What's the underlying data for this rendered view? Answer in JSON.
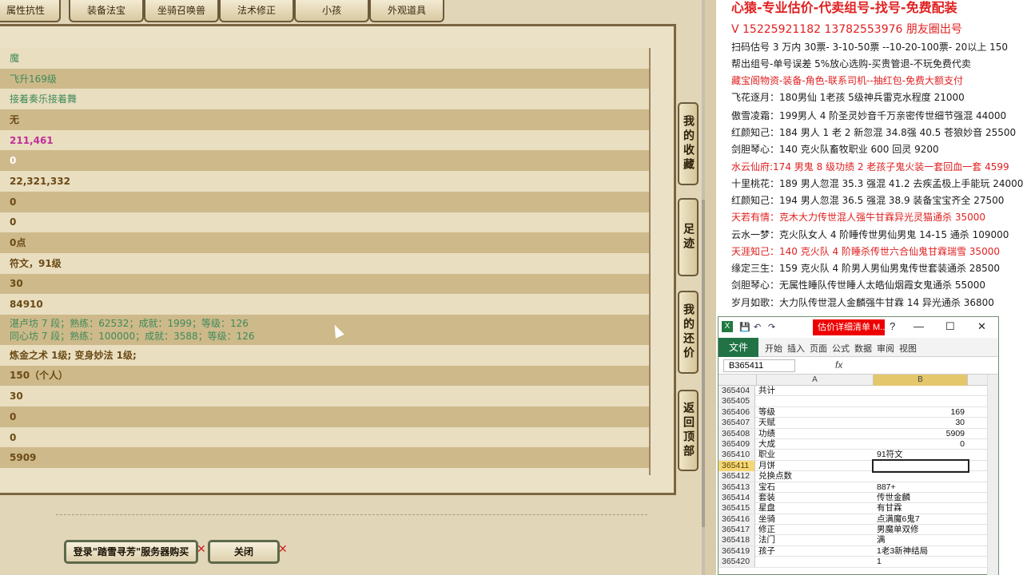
{
  "tabs": [
    "属性抗性",
    "装备法宝",
    "坐骑召唤兽",
    "法术修正",
    "小孩",
    "外观道具"
  ],
  "rows": [
    {
      "text": "魔",
      "style": "green"
    },
    {
      "text": "飞升169级",
      "style": "green"
    },
    {
      "text": "接着奏乐接着舞",
      "style": "green"
    },
    {
      "text": "无",
      "style": "normal"
    },
    {
      "text": "211,461",
      "style": "magenta"
    },
    {
      "text": "0",
      "style": "white"
    },
    {
      "text": "22,321,332",
      "style": "normal"
    },
    {
      "text": "0",
      "style": "normal"
    },
    {
      "text": "0",
      "style": "normal"
    },
    {
      "text": "0点",
      "style": "normal"
    },
    {
      "text": "符文，91级",
      "style": "normal"
    },
    {
      "text": "30",
      "style": "normal"
    },
    {
      "text": "84910",
      "style": "normal"
    },
    {
      "text": "湛卢坊 7 段；熟练：62532；成就：1999；等级：126",
      "text2": "同心坊 7 段；熟练：100000；成就：3588；等级：126",
      "style": "green-mixed"
    },
    {
      "text": "炼金之术 1级; 变身妙法 1级;",
      "style": "normal"
    },
    {
      "text": "150（个人）",
      "style": "normal"
    },
    {
      "text": "30",
      "style": "normal"
    },
    {
      "text": "0",
      "style": "normal"
    },
    {
      "text": "0",
      "style": "normal"
    },
    {
      "text": "5909",
      "style": "normal"
    }
  ],
  "side_buttons": {
    "favorites": "我的收藏",
    "footprints": "足迹",
    "my_offer": "我的还价",
    "back_to_top": "返回顶部"
  },
  "bottom_buttons": {
    "login": "登录\"踏雪寻芳\"服务器购买",
    "close": "关闭"
  },
  "doc_lines": [
    {
      "text": "心猿-专业估价-代卖组号-找号-免费配装",
      "color": "red",
      "size": "big"
    },
    {
      "text": "V 15225921182   13782553976 朋友圈出号",
      "color": "red",
      "size": "med"
    },
    {
      "text": "扫码估号 3 万内 30票- 3-10-50票 --10-20-100票- 20以上 150",
      "color": "black"
    },
    {
      "text": "帮出组号-单号误差 5%放心选购-买贵管退-不玩免费代卖",
      "color": "black"
    },
    {
      "text": "藏宝阁物资-装备-角色-联系司机--抽红包-免费大额支付",
      "color": "red"
    },
    {
      "text": "飞花逐月：180男仙 1老孩 5级神兵雷克水程度 21000",
      "color": "black"
    },
    {
      "text": "傲雪凌霜：199男人 4 阶圣灵妙音千万亲密传世细节强混 44000",
      "color": "black"
    },
    {
      "text": "红颜知己：184 男人 1 老 2 新忽混 34.8强 40.5 苍狼妙音 25500",
      "color": "black"
    },
    {
      "text": "剑胆琴心：140 克火队畜牧职业 600 回灵 9200",
      "color": "black"
    },
    {
      "text": "水云仙府:174 男鬼 8 级功绩 2 老孩子鬼火装一套回血一套 4599",
      "color": "red"
    },
    {
      "text": "十里桃花：189 男人忽混 35.3 强混 41.2 去疾孟极上手能玩 24000",
      "color": "black"
    },
    {
      "text": "红颜知己：194 男人忽混 36.5 强混 38.9 装备宝宝齐全 27500",
      "color": "black"
    },
    {
      "text": "天若有情：克木大力传世混人强牛甘霖异光灵猫通杀 35000",
      "color": "red"
    },
    {
      "text": "云水一梦：克火队女人 4 阶睡传世男仙男鬼 14-15 通杀 109000",
      "color": "black"
    },
    {
      "text": "天涯知己：140 克火队 4 阶睡杀传世六合仙鬼甘霖瑞雪 35000",
      "color": "red"
    },
    {
      "text": "缘定三生：159 克火队 4 阶男人男仙男鬼传世套装通杀 28500",
      "color": "black"
    },
    {
      "text": "剑胆琴心：无属性睡队传世睡人太皓仙烟霞女鬼通杀 55000",
      "color": "black"
    },
    {
      "text": "岁月如歌：大力队传世混人金麟强牛甘霖 14 异光通杀 36800",
      "color": "black"
    }
  ],
  "excel": {
    "title": "估价详细清单 M...",
    "quick_access": [
      "💾",
      "↶",
      "↷"
    ],
    "window_buttons": [
      "?",
      "—",
      "☐",
      "✕"
    ],
    "file_tab": "文件",
    "tabs": [
      "开始",
      "插入",
      "页面",
      "公式",
      "数据",
      "审阅",
      "视图"
    ],
    "name_box": "B365411",
    "fx": "fx",
    "columns": [
      "A",
      "B"
    ],
    "rows": [
      {
        "n": "365404",
        "a": "共计",
        "b": "",
        "num": false
      },
      {
        "n": "365405",
        "a": "",
        "b": "",
        "num": false
      },
      {
        "n": "365406",
        "a": "等级",
        "b": "169",
        "num": true
      },
      {
        "n": "365407",
        "a": "天赋",
        "b": "30",
        "num": true
      },
      {
        "n": "365408",
        "a": "功绩",
        "b": "5909",
        "num": true
      },
      {
        "n": "365409",
        "a": "大成",
        "b": "0",
        "num": true
      },
      {
        "n": "365410",
        "a": "职业",
        "b": "91符文",
        "num": false
      },
      {
        "n": "365411",
        "a": "月饼",
        "b": "",
        "num": false,
        "selected": true
      },
      {
        "n": "365412",
        "a": "兑换点数",
        "b": "",
        "num": false
      },
      {
        "n": "365413",
        "a": "宝石",
        "b": "887+",
        "num": false
      },
      {
        "n": "365414",
        "a": "套装",
        "b": "传世金麟",
        "num": false
      },
      {
        "n": "365415",
        "a": "星盘",
        "b": "有甘霖",
        "num": false
      },
      {
        "n": "365416",
        "a": "坐骑",
        "b": "点满魔6鬼7",
        "num": false
      },
      {
        "n": "365417",
        "a": "修正",
        "b": "男魔单双修",
        "num": false
      },
      {
        "n": "365418",
        "a": "法门",
        "b": "满",
        "num": false
      },
      {
        "n": "365419",
        "a": "孩子",
        "b": "1老3新神结局",
        "num": false
      },
      {
        "n": "365420",
        "a": "",
        "b": "1",
        "num": false
      }
    ]
  }
}
